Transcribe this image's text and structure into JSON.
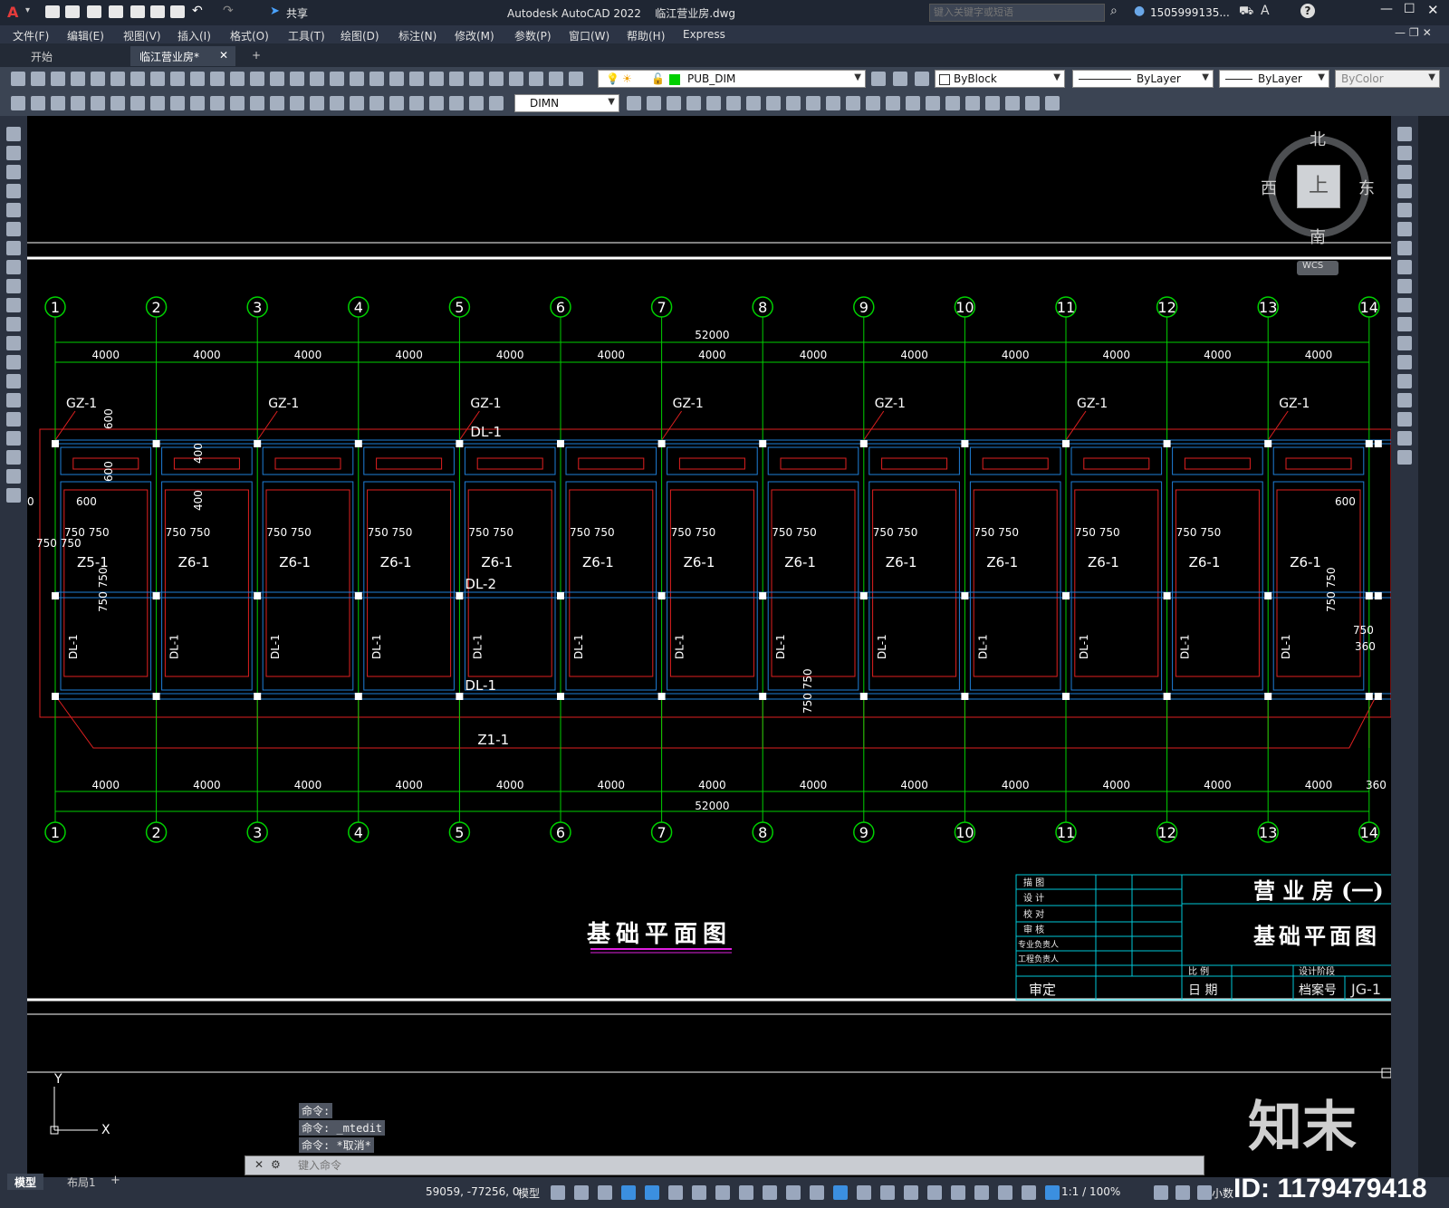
{
  "title": {
    "app": "Autodesk AutoCAD 2022",
    "file": "临江营业房.dwg",
    "share": "共享",
    "search_placeholder": "键入关键字或短语",
    "user": "1505999135...",
    "help_icon": "question-icon"
  },
  "menu": [
    "文件(F)",
    "编辑(E)",
    "视图(V)",
    "插入(I)",
    "格式(O)",
    "工具(T)",
    "绘图(D)",
    "标注(N)",
    "修改(M)",
    "参数(P)",
    "窗口(W)",
    "帮助(H)",
    "Express"
  ],
  "tabs": {
    "start": "开始",
    "doc": "临江营业房*",
    "new": "+"
  },
  "toolbar": {
    "layer": "PUB_DIM",
    "color": "ByBlock",
    "linetype": "ByLayer",
    "lineweight": "ByLayer",
    "plotstyle": "ByColor",
    "dimstyle": "DIMN"
  },
  "viewcube": {
    "north": "北",
    "south": "南",
    "east": "东",
    "west": "西",
    "top": "上",
    "wcs": "WCS"
  },
  "drawing": {
    "axes": [
      "1",
      "2",
      "3",
      "4",
      "5",
      "6",
      "7",
      "8",
      "9",
      "10",
      "11",
      "12",
      "13",
      "14"
    ],
    "bay": "4000",
    "total": "52000",
    "labels": {
      "gz": "GZ-1",
      "dl1": "DL-1",
      "dl2": "DL-2",
      "z5": "Z5-1",
      "z6": "Z6-1",
      "z1": "Z1-1",
      "d600": "600",
      "d400": "400",
      "d750": "750",
      "d750750": "750 750",
      "d360": "360",
      "d0": "0"
    },
    "heading": "基础平面图",
    "titleblock": {
      "roles": [
        "描 图",
        "设 计",
        "校 对",
        "审 核",
        "专业负责人",
        "工程负责人"
      ],
      "project": "营 业 房 (一)",
      "sheet": "基础平面图",
      "approve": "审定",
      "scale": "比 例",
      "date": "日 期",
      "stage": "设计阶段",
      "archive": "档案号",
      "no": "JG-1"
    }
  },
  "commands": {
    "line1": "命令:",
    "line2": "命令: _mtedit",
    "line3": "命令: *取消*",
    "placeholder": "键入命令"
  },
  "ucs": {
    "x": "X",
    "y": "Y"
  },
  "layouts": {
    "model": "模型",
    "layout1": "布局1",
    "add": "+"
  },
  "status": {
    "coords": "59059, -77256, 0",
    "space": "模型",
    "scale": "1:1 / 100%",
    "units": "小数"
  },
  "watermark": {
    "brand": "知末",
    "id": "ID: 1179479418"
  }
}
